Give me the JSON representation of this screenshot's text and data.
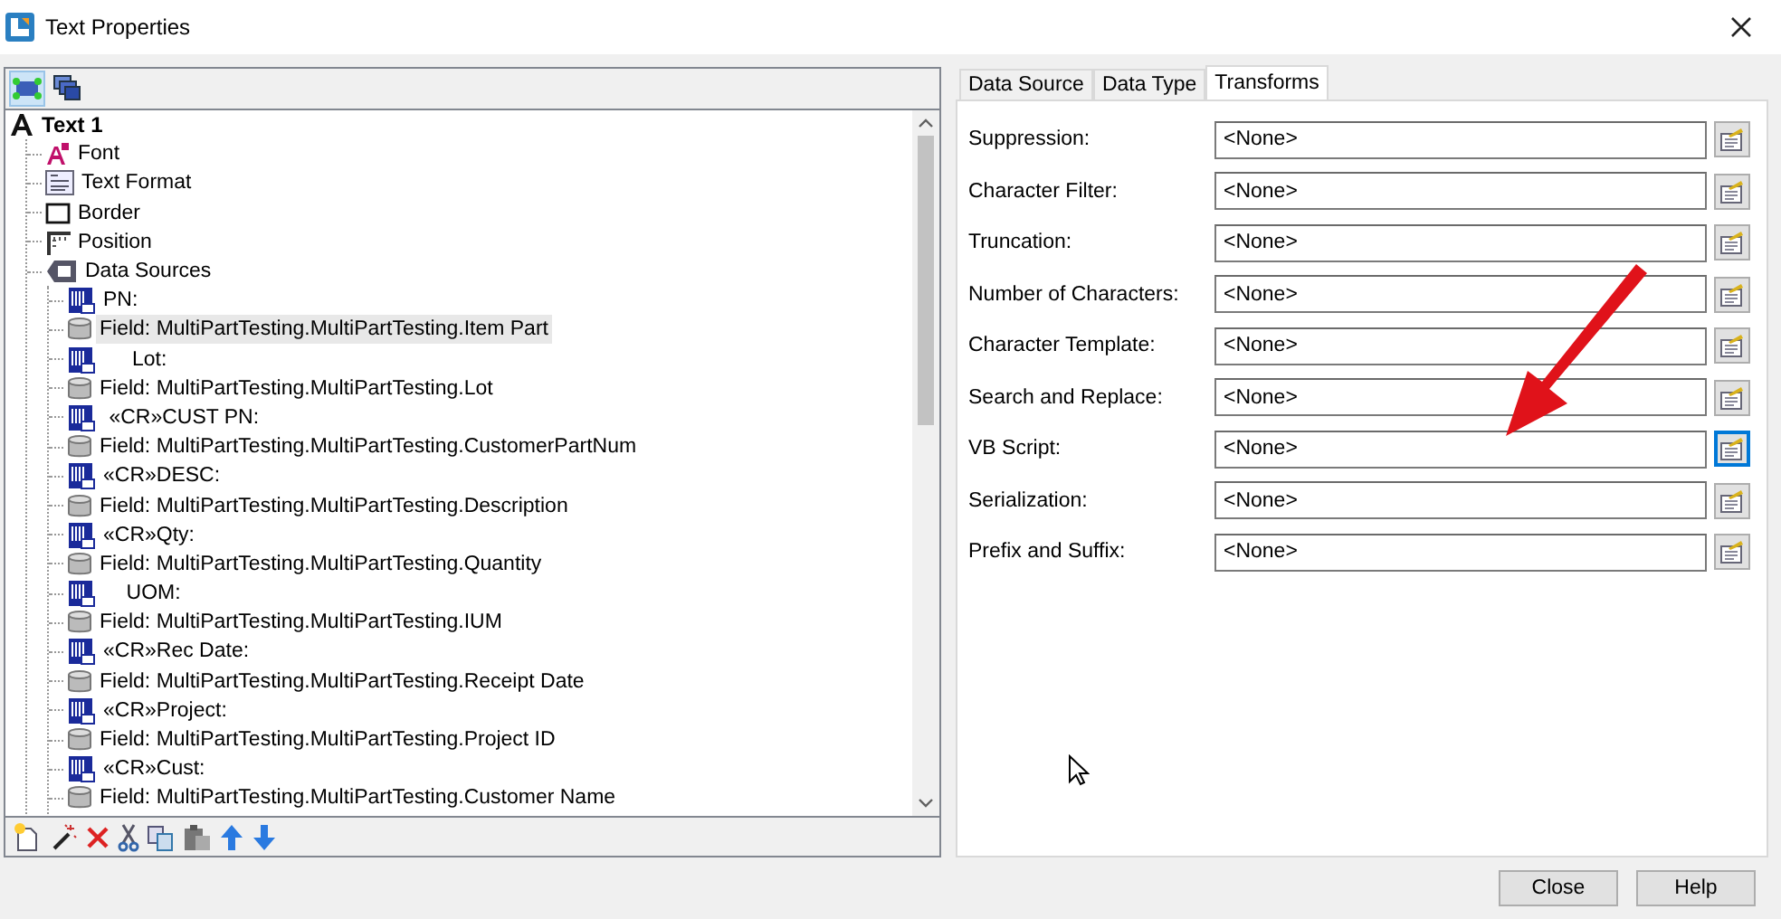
{
  "window": {
    "title": "Text Properties"
  },
  "tree": {
    "items": [
      {
        "label": "Text 1",
        "kind": "text",
        "selected": false,
        "children": [
          {
            "label": "Font",
            "kind": "font",
            "selected": false
          },
          {
            "label": "Text Format",
            "kind": "format",
            "selected": false
          },
          {
            "label": "Border",
            "kind": "border",
            "selected": false
          },
          {
            "label": "Position",
            "kind": "position",
            "selected": false
          },
          {
            "label": "Data Sources",
            "kind": "sources",
            "selected": false,
            "children": [
              {
                "label": "PN:",
                "kind": "static",
                "selected": false
              },
              {
                "label": "Field: MultiPartTesting.MultiPartTesting.Item Part",
                "kind": "field",
                "selected": true
              },
              {
                "label": "     Lot:",
                "kind": "static",
                "selected": false
              },
              {
                "label": "Field: MultiPartTesting.MultiPartTesting.Lot",
                "kind": "field",
                "selected": false
              },
              {
                "label": " «CR»CUST PN:",
                "kind": "static",
                "selected": false
              },
              {
                "label": "Field: MultiPartTesting.MultiPartTesting.CustomerPartNum",
                "kind": "field",
                "selected": false
              },
              {
                "label": "«CR»DESC:",
                "kind": "static",
                "selected": false
              },
              {
                "label": "Field: MultiPartTesting.MultiPartTesting.Description",
                "kind": "field",
                "selected": false
              },
              {
                "label": "«CR»Qty:",
                "kind": "static",
                "selected": false
              },
              {
                "label": "Field: MultiPartTesting.MultiPartTesting.Quantity",
                "kind": "field",
                "selected": false
              },
              {
                "label": "    UOM:",
                "kind": "static",
                "selected": false
              },
              {
                "label": "Field: MultiPartTesting.MultiPartTesting.IUM",
                "kind": "field",
                "selected": false
              },
              {
                "label": "«CR»Rec Date:",
                "kind": "static",
                "selected": false
              },
              {
                "label": "Field: MultiPartTesting.MultiPartTesting.Receipt Date",
                "kind": "field",
                "selected": false
              },
              {
                "label": "«CR»Project:",
                "kind": "static",
                "selected": false
              },
              {
                "label": "Field: MultiPartTesting.MultiPartTesting.Project ID",
                "kind": "field",
                "selected": false
              },
              {
                "label": "«CR»Cust:",
                "kind": "static",
                "selected": false
              },
              {
                "label": "Field: MultiPartTesting.MultiPartTesting.Customer Name",
                "kind": "field",
                "selected": false
              }
            ]
          }
        ]
      }
    ]
  },
  "tabs": [
    {
      "label": "Data Source",
      "selected": false
    },
    {
      "label": "Data Type",
      "selected": false
    },
    {
      "label": "Transforms",
      "selected": true
    }
  ],
  "transforms": [
    {
      "label": "Suppression:",
      "value": "<None>",
      "focused": false
    },
    {
      "label": "Character Filter:",
      "value": "<None>",
      "focused": false
    },
    {
      "label": "Truncation:",
      "value": "<None>",
      "focused": false
    },
    {
      "label": "Number of Characters:",
      "value": "<None>",
      "focused": false
    },
    {
      "label": "Character Template:",
      "value": "<None>",
      "focused": false
    },
    {
      "label": "Search and Replace:",
      "value": "<None>",
      "focused": false
    },
    {
      "label": "VB Script:",
      "value": "<None>",
      "focused": true
    },
    {
      "label": "Serialization:",
      "value": "<None>",
      "focused": false
    },
    {
      "label": "Prefix and Suffix:",
      "value": "<None>",
      "focused": false
    }
  ],
  "buttons": [
    "Close",
    "Help"
  ]
}
